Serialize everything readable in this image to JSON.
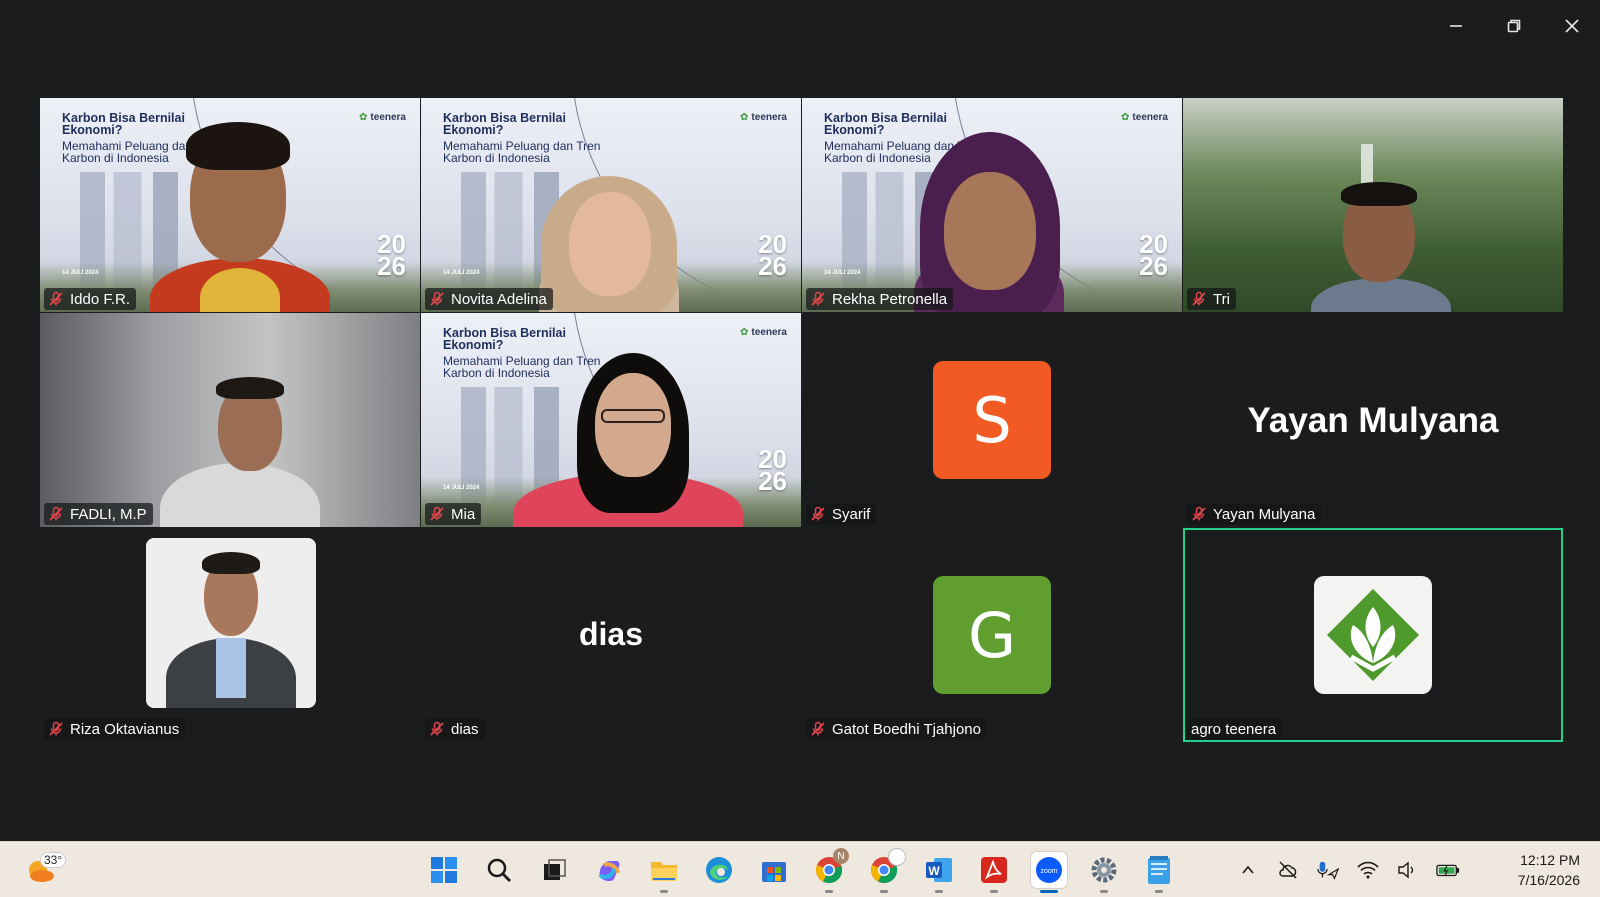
{
  "window": {
    "minimize_icon": "minimize-icon",
    "restore_icon": "restore-icon",
    "close_icon": "close-icon"
  },
  "slide": {
    "title": "Karbon Bisa Bernilai Ekonomi?",
    "subtitle": "Memahami Peluang dan Tren Karbon di Indonesia",
    "brand": "teenera",
    "year_top": "20",
    "year_bottom": "26",
    "date": "14 JULI 2024"
  },
  "participants": [
    {
      "name": "Iddo F.R.",
      "type": "video-slide",
      "muted": true
    },
    {
      "name": "Novita Adelina",
      "type": "video-slide",
      "muted": true
    },
    {
      "name": "Rekha Petronella",
      "type": "video-slide",
      "muted": true
    },
    {
      "name": "Tri",
      "type": "video-nature",
      "muted": true
    },
    {
      "name": "FADLI, M.P",
      "type": "video-room",
      "muted": true
    },
    {
      "name": "Mia",
      "type": "video-slide",
      "muted": true
    },
    {
      "name": "Syarif",
      "type": "avatar-letter",
      "letter": "S",
      "color": "#f15a22",
      "muted": true
    },
    {
      "name": "Yayan Mulyana",
      "type": "name-only",
      "display": "Yayan Mulyana",
      "muted": true
    },
    {
      "name": "Riza Oktavianus",
      "type": "photo",
      "muted": true
    },
    {
      "name": "dias",
      "type": "name-only",
      "display": "dias",
      "muted": true
    },
    {
      "name": "Gatot Boedhi Tjahjono",
      "type": "avatar-letter",
      "letter": "G",
      "color": "#5f9e2f",
      "muted": true
    },
    {
      "name": "agro teenera",
      "type": "logo",
      "muted": false,
      "active_speaker": true
    }
  ],
  "colors": {
    "background": "#1a1c1e",
    "active_speaker_border": "#23d18b",
    "mic_off": "#e0474c"
  },
  "taskbar": {
    "weather_temp": "33°",
    "apps": [
      "windows-start-icon",
      "search-icon",
      "task-view-icon",
      "copilot-icon",
      "file-explorer-icon",
      "edge-icon",
      "store-icon",
      "chrome-icon",
      "chrome-profile-icon",
      "word-icon",
      "acrobat-icon",
      "zoom-icon",
      "settings-icon",
      "notepad-icon"
    ],
    "chrome_badge": "N",
    "tray": [
      "chevron-up-icon",
      "cloud-off-icon",
      "microphone-icon",
      "wifi-icon",
      "volume-icon",
      "battery-icon"
    ],
    "time": "12:12 PM",
    "date": "7/16/2026"
  }
}
